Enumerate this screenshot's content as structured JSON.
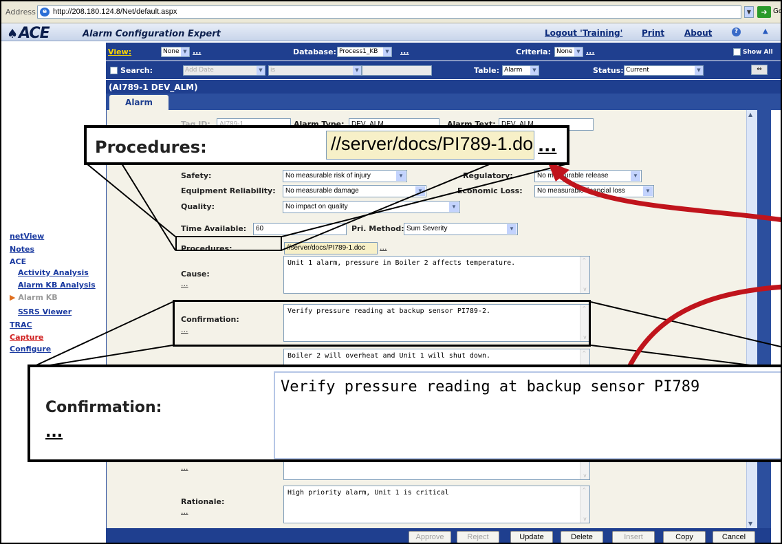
{
  "browser": {
    "address_label": "Address",
    "url": "http://208.180.124.8/Net/default.aspx",
    "go_label": "Go"
  },
  "header": {
    "logo": "ACE",
    "app_title": "Alarm Configuration Expert",
    "logout": "Logout 'Training'",
    "print": "Print",
    "about": "About"
  },
  "sidebar": {
    "items": [
      {
        "label": "netView"
      },
      {
        "label": "Notes"
      },
      {
        "label": "ACE"
      },
      {
        "label": "Activity Analysis"
      },
      {
        "label": "Alarm KB Analysis"
      },
      {
        "label": "Alarm KB"
      },
      {
        "label": "SSRS Viewer"
      },
      {
        "label": "TRAC"
      },
      {
        "label": "Capture"
      },
      {
        "label": "Configure"
      }
    ]
  },
  "filters": {
    "view_label": "View:",
    "view_value": "None",
    "database_label": "Database:",
    "database_value": "Process1_KB",
    "criteria_label": "Criteria:",
    "criteria_value": "None",
    "show_all": "Show All",
    "search_label": "Search:",
    "search_field": "Add Date",
    "search_op": "is",
    "table_label": "Table:",
    "table_value": "Alarm",
    "status_label": "Status:",
    "status_value": "Current",
    "dots": "..."
  },
  "record": {
    "title": "(AI789-1 DEV_ALM)",
    "tab": "Alarm"
  },
  "form": {
    "tag_id_label": "Tag ID:",
    "tag_id_value": "AI789-1",
    "alarm_type_label": "Alarm Type:",
    "alarm_type_value": "DEV_ALM",
    "alarm_text_label": "Alarm Text:",
    "alarm_text_value": "DEV_ALM",
    "safety_label": "Safety:",
    "safety_value": "No measurable risk of injury",
    "regulatory_label": "Regulatory:",
    "regulatory_value": "No measurable release",
    "equip_label": "Equipment Reliability:",
    "equip_value": "No measurable damage",
    "economic_label": "Economic Loss:",
    "economic_value": "No measurable financial loss",
    "quality_label": "Quality:",
    "quality_value": "No impact on quality",
    "time_label": "Time Available:",
    "time_value": "60",
    "pri_label": "Pri. Method:",
    "pri_value": "Sum Severity",
    "procedures_label": "Procedures:",
    "procedures_value": "//server/docs/PI789-1.doc",
    "cause_label": "Cause:",
    "cause_value": "Unit 1 alarm, pressure in Boiler 2 affects temperature.",
    "confirmation_label": "Confirmation:",
    "confirmation_value": "Verify pressure reading at backup sensor PI789-2.",
    "consequences_value": "Boiler 2 will overheat and Unit 1 will shut down.",
    "rationale_label": "Rationale:",
    "rationale_value": "High priority alarm, Unit 1 is critical",
    "dots": "..."
  },
  "buttons": {
    "approve": "Approve",
    "reject": "Reject",
    "update": "Update",
    "delete": "Delete",
    "insert": "Insert",
    "copy": "Copy",
    "cancel": "Cancel"
  },
  "callouts": {
    "procedures_label": "Procedures:",
    "procedures_value": "//server/docs/PI789-1.doc",
    "confirmation_label": "Confirmation:",
    "confirmation_value": "Verify pressure reading at backup sensor PI789",
    "dots": "..."
  },
  "colors": {
    "nav_blue": "#1f3f8f",
    "form_bg": "#f4f2e8",
    "arrow_red": "#c0141c",
    "capture_red": "#d02020"
  }
}
